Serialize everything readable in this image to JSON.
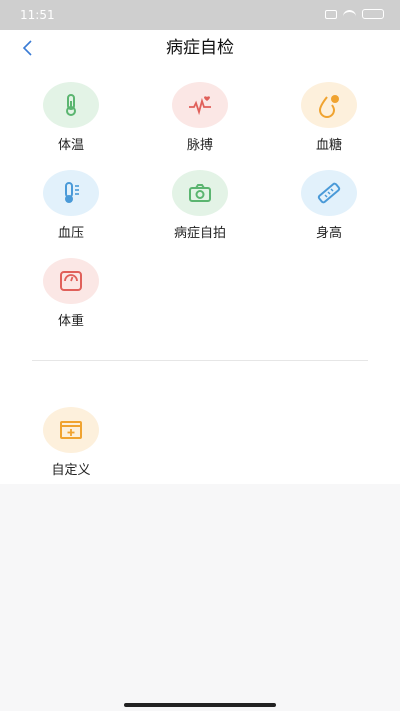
{
  "status_bar": {
    "time": "11:51"
  },
  "header": {
    "title": "病症自检",
    "back_icon": "chevron-left-icon"
  },
  "items": [
    {
      "label": "体温",
      "icon": "thermometer-icon",
      "bg": "#e3f3e6",
      "color": "#5bb570"
    },
    {
      "label": "脉搏",
      "icon": "heartbeat-icon",
      "bg": "#fbe7e5",
      "color": "#e0605a"
    },
    {
      "label": "血糖",
      "icon": "glucose-drop-icon",
      "bg": "#fdf0dc",
      "color": "#f0a330"
    },
    {
      "label": "血压",
      "icon": "blood-pressure-thermometer-icon",
      "bg": "#e2f1fb",
      "color": "#4a9ad8"
    },
    {
      "label": "病症自拍",
      "icon": "camera-icon",
      "bg": "#e3f3e6",
      "color": "#5bb570"
    },
    {
      "label": "身高",
      "icon": "ruler-icon",
      "bg": "#e2f1fb",
      "color": "#4a9ad8"
    },
    {
      "label": "体重",
      "icon": "scale-icon",
      "bg": "#fbe7e5",
      "color": "#e0605a"
    }
  ],
  "custom": {
    "label": "自定义",
    "icon": "custom-box-icon",
    "bg": "#fdf0dc",
    "color": "#f0a330"
  }
}
